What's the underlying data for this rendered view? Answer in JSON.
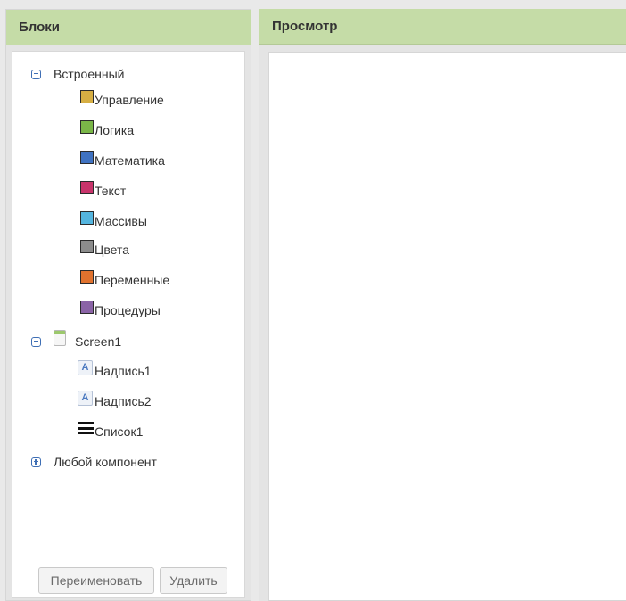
{
  "blocks_panel": {
    "title": "Блоки",
    "builtin": {
      "label": "Встроенный",
      "items": [
        {
          "label": "Управление",
          "color": "#d6ae43"
        },
        {
          "label": "Логика",
          "color": "#7ab648"
        },
        {
          "label": "Математика",
          "color": "#3f72c1"
        },
        {
          "label": "Текст",
          "color": "#c8346b"
        },
        {
          "label": "Массивы",
          "color": "#54b5df"
        },
        {
          "label": "Цвета",
          "color": "#8c8c8c"
        },
        {
          "label": "Переменные",
          "color": "#e0722e"
        },
        {
          "label": "Процедуры",
          "color": "#8a63a6"
        }
      ]
    },
    "screen": {
      "label": "Screen1",
      "children": [
        {
          "label": "Надпись1",
          "icon": "label-component-icon"
        },
        {
          "label": "Надпись2",
          "icon": "label-component-icon"
        },
        {
          "label": "Список1",
          "icon": "list-view-icon"
        }
      ]
    },
    "any_component": {
      "label": "Любой компонент"
    },
    "buttons": {
      "rename": "Переименовать",
      "delete": "Удалить"
    }
  },
  "viewer_panel": {
    "title": "Просмотр"
  }
}
